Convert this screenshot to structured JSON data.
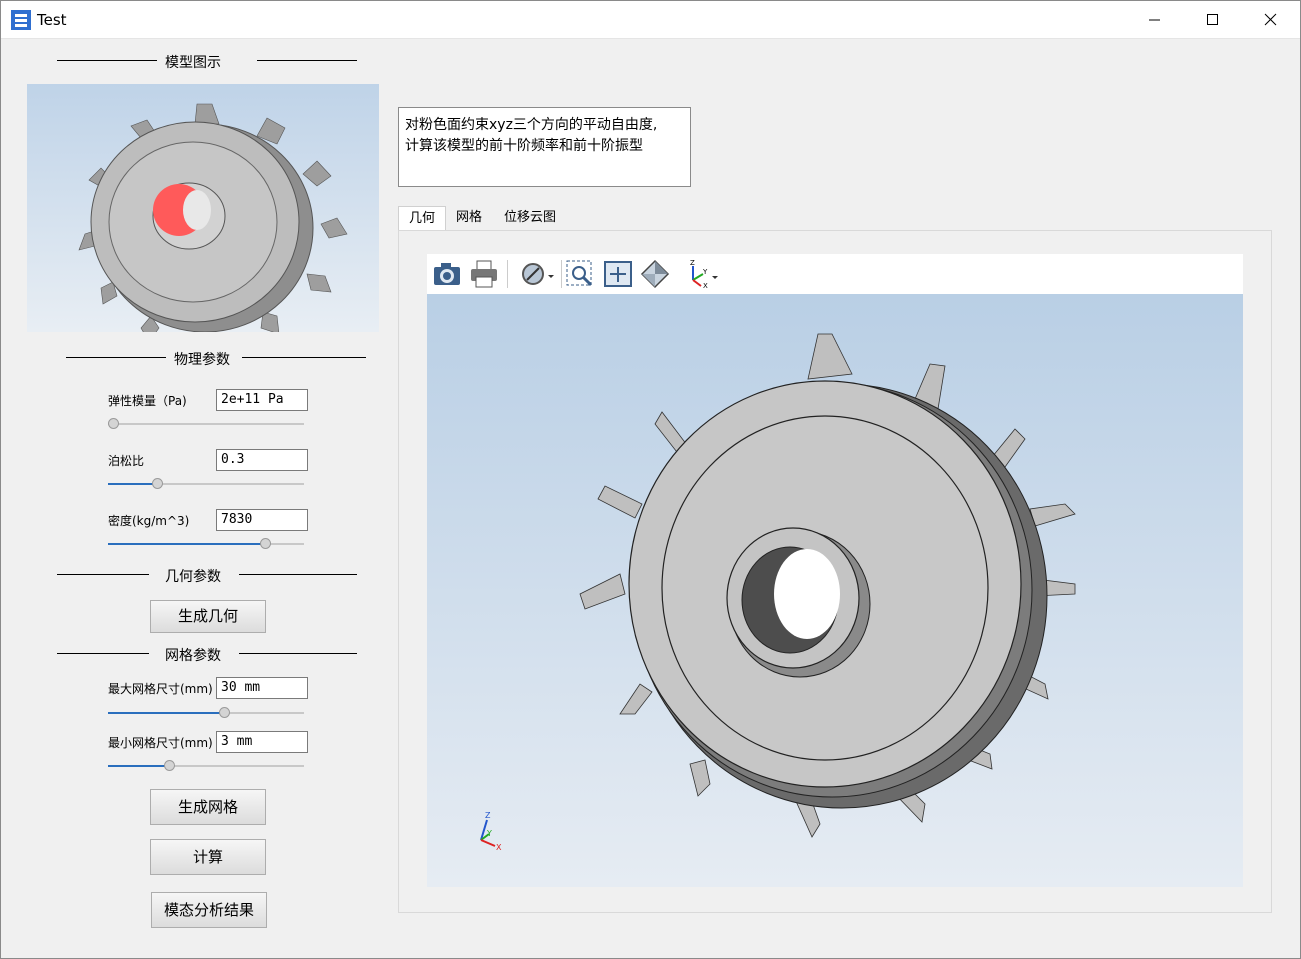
{
  "window": {
    "title": "Test"
  },
  "left_panel": {
    "model_section": "模型图示",
    "physical_section": "物理参数",
    "elastic_label": "弹性模量（Pa)",
    "elastic_value": "2e+11 Pa",
    "elastic_slider": 0.0,
    "poisson_label": "泊松比",
    "poisson_value": "0.3",
    "poisson_slider": 0.24,
    "density_label": "密度(kg/m^3)",
    "density_value": "7830",
    "density_slider": 0.82,
    "geometry_section": "几何参数",
    "gen_geometry_button": "生成几何",
    "mesh_section": "网格参数",
    "max_mesh_label": "最大网格尺寸(mm)",
    "max_mesh_value": "30 mm",
    "max_mesh_slider": 0.6,
    "min_mesh_label": "最小网格尺寸(mm)",
    "min_mesh_value": "3 mm",
    "min_mesh_slider": 0.3,
    "gen_mesh_button": "生成网格",
    "compute_button": "计算",
    "results_button": "模态分析结果"
  },
  "description": {
    "line1": "对粉色面约束xyz三个方向的平动自由度,",
    "line2": "计算该模型的前十阶频率和前十阶振型"
  },
  "tabs": [
    "几何",
    "网格",
    "位移云图"
  ],
  "active_tab": "几何",
  "toolbar": [
    "camera-icon",
    "print-icon",
    "display-mode-icon",
    "zoom-box-icon",
    "fit-all-icon",
    "view-cube-icon",
    "axis-orientation-icon"
  ],
  "triad": {
    "x": "X",
    "y": "Y",
    "z": "Z"
  },
  "colors": {
    "accent": "#2a6ebd",
    "constraint_face": "#ff5a5a",
    "gear": "#c4c4c4"
  }
}
